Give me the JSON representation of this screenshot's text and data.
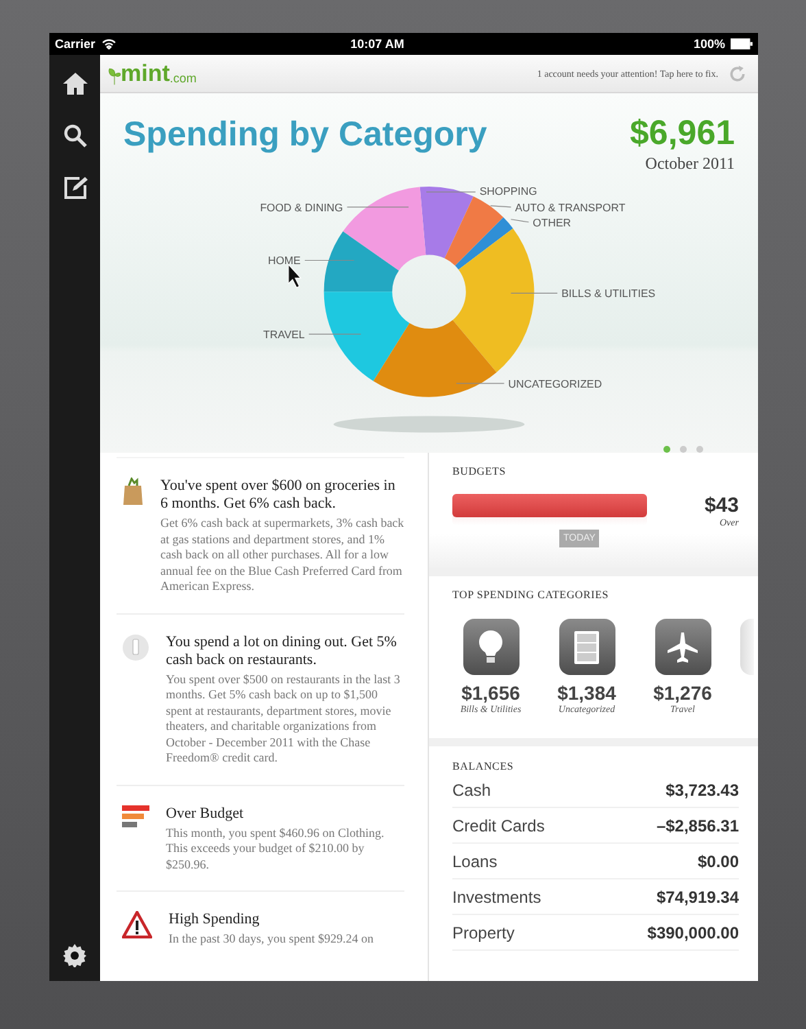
{
  "status_bar": {
    "carrier": "Carrier",
    "time": "10:07 AM",
    "battery": "100%"
  },
  "header": {
    "logo": "mint",
    "logo_suffix": ".com",
    "notice": "1 account needs your attention! Tap here to fix."
  },
  "hero": {
    "title": "Spending by Category",
    "total": "$6,961",
    "period": "October 2011"
  },
  "chart_labels": [
    {
      "label": "SHOPPING",
      "color": "#a77be8"
    },
    {
      "label": "FOOD & DINING",
      "color": "#f29ae0"
    },
    {
      "label": "AUTO & TRANSPORT",
      "color": "#f07a45"
    },
    {
      "label": "OTHER",
      "color": "#2f8fd6"
    },
    {
      "label": "HOME",
      "color": "#23a8c2"
    },
    {
      "label": "BILLS & UTILITIES",
      "color": "#efbd22"
    },
    {
      "label": "TRAVEL",
      "color": "#1ec8e0"
    },
    {
      "label": "UNCATEGORIZED",
      "color": "#e08c10"
    }
  ],
  "page_dots": [
    {
      "selected": true
    },
    {
      "selected": false
    },
    {
      "selected": false
    }
  ],
  "feed": [
    {
      "kind": "grocery",
      "title": "You've spent over $600 on groceries in 6 months. Get 6% cash back.",
      "body": "Get 6% cash back at supermarkets, 3% cash back at gas stations and department stores, and 1% cash back on all other purchases. All for a low annual fee on the Blue Cash Preferred Card from American Express."
    },
    {
      "kind": "dining",
      "title": "You spend a lot on dining out. Get 5% cash back on restaurants.",
      "body": "You spent over $500 on restaurants in the last 3 months. Get 5% cash back on up to $1,500 spent at restaurants, department stores, movie theaters, and charitable organizations from October - December 2011 with the Chase Freedom® credit card."
    },
    {
      "kind": "budget",
      "title": "Over Budget",
      "body": "This month, you spent $460.96 on Clothing. This exceeds your budget of $210.00 by $250.96."
    },
    {
      "kind": "alert",
      "title": "High Spending",
      "body": "In the past 30 days, you spent $929.24 on"
    }
  ],
  "budgets": {
    "heading": "BUDGETS",
    "level": 1,
    "marker": "TODAY",
    "amount": "$43",
    "note": "Over"
  },
  "top_categories": {
    "heading": "TOP SPENDING CATEGORIES",
    "items": [
      {
        "kind": "bulb",
        "amount": "$1,656",
        "label": "Bills & Utilities"
      },
      {
        "kind": "cabinet",
        "amount": "$1,384",
        "label": "Uncategorized"
      },
      {
        "kind": "plane",
        "amount": "$1,276",
        "label": "Travel"
      }
    ]
  },
  "balances": {
    "heading": "BALANCES",
    "rows": [
      {
        "name": "Cash",
        "value": "$3,723.43"
      },
      {
        "name": "Credit Cards",
        "value": "–$2,856.31"
      },
      {
        "name": "Loans",
        "value": "$0.00"
      },
      {
        "name": "Investments",
        "value": "$74,919.34"
      },
      {
        "name": "Property",
        "value": "$390,000.00"
      }
    ]
  }
}
